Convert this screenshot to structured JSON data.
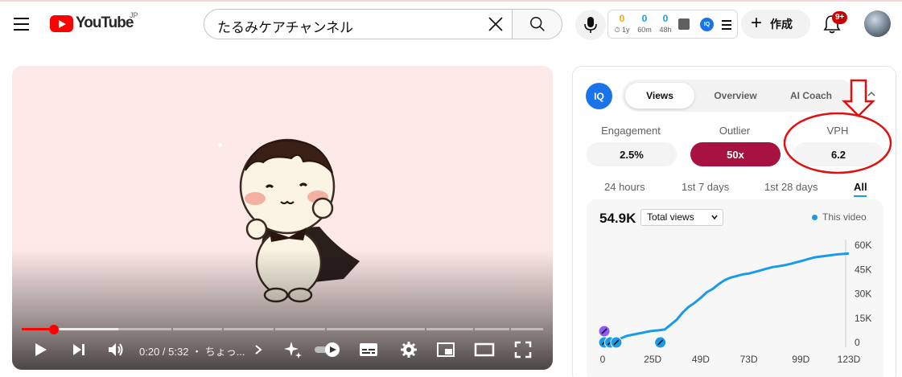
{
  "header": {
    "logo_text": "YouTube",
    "logo_country": "JP",
    "search_value": "たるみケアチャンネル",
    "stats": [
      {
        "value": "0",
        "label": "⏱ 1y",
        "color": "#f2a900"
      },
      {
        "value": "0",
        "label": "60m",
        "color": "#1a9ae8"
      },
      {
        "value": "0",
        "label": "48h",
        "color": "#1a9ae8"
      }
    ],
    "ext_badge": "IQ",
    "create_label": "作成",
    "notification_count": "9+"
  },
  "player": {
    "time": "0:20 / 5:32",
    "chapter": "・ ちょっ...",
    "progress_fraction": 0.06
  },
  "panel": {
    "logo": "IQ",
    "tabs": [
      {
        "label": "Views",
        "active": true
      },
      {
        "label": "Overview",
        "active": false
      },
      {
        "label": "AI Coach",
        "active": false
      }
    ],
    "metrics": [
      {
        "label": "Engagement",
        "value": "2.5%"
      },
      {
        "label": "Outlier",
        "value": "50x"
      },
      {
        "label": "VPH",
        "value": "6.2"
      }
    ],
    "ranges": [
      {
        "label": "24 hours",
        "active": false
      },
      {
        "label": "1st 7 days",
        "active": false
      },
      {
        "label": "1st 28 days",
        "active": false
      },
      {
        "label": "All",
        "active": true
      }
    ],
    "total_value": "54.9K",
    "total_select": "Total views",
    "legend": "This video",
    "accent": "#1a9ae8",
    "outlier_color": "#a8123e"
  },
  "chart_data": {
    "type": "line",
    "x_ticks": [
      "0",
      "25D",
      "49D",
      "73D",
      "99D",
      "123D"
    ],
    "y_ticks": [
      "60K",
      "45K",
      "30K",
      "15K",
      "0"
    ],
    "xlim": [
      0,
      123
    ],
    "ylim": [
      0,
      60000
    ],
    "series": [
      {
        "name": "This video",
        "x": [
          0,
          3,
          6,
          9,
          12,
          16,
          20,
          24,
          28,
          31,
          34,
          37,
          40,
          43,
          46,
          49,
          52,
          55,
          58,
          61,
          64,
          67,
          70,
          73,
          76,
          79,
          82,
          85,
          88,
          91,
          94,
          97,
          100,
          103,
          106,
          109,
          112,
          115,
          118,
          121,
          123
        ],
        "y": [
          0,
          300,
          800,
          2500,
          4000,
          5000,
          6000,
          7000,
          7500,
          8000,
          11000,
          14000,
          18500,
          22000,
          24500,
          27500,
          31000,
          33000,
          36000,
          38500,
          40000,
          41000,
          42000,
          42500,
          43500,
          44500,
          45500,
          46500,
          47000,
          47700,
          48500,
          49500,
          50500,
          51500,
          52500,
          53000,
          53500,
          54000,
          54400,
          54700,
          54900
        ]
      }
    ],
    "grid": false,
    "legend": "top-right"
  }
}
